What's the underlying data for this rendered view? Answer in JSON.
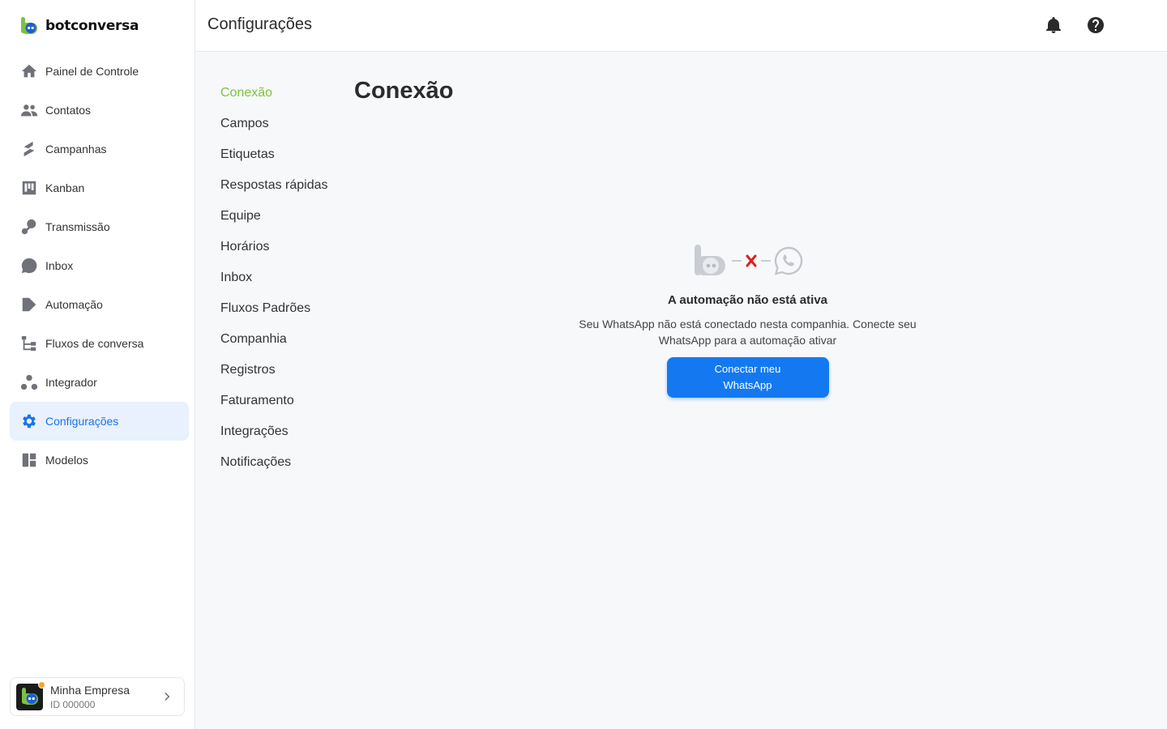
{
  "brand": {
    "name": "botconversa",
    "accent": "#7cc242",
    "primary": "#1479f0"
  },
  "sidebar": {
    "items": [
      {
        "label": "Painel de Controle",
        "icon": "home-icon"
      },
      {
        "label": "Contatos",
        "icon": "contacts-icon"
      },
      {
        "label": "Campanhas",
        "icon": "campaigns-icon"
      },
      {
        "label": "Kanban",
        "icon": "kanban-icon"
      },
      {
        "label": "Transmissão",
        "icon": "broadcast-icon"
      },
      {
        "label": "Inbox",
        "icon": "chat-bubble-icon"
      },
      {
        "label": "Automação",
        "icon": "automation-icon"
      },
      {
        "label": "Fluxos de conversa",
        "icon": "flow-icon"
      },
      {
        "label": "Integrador",
        "icon": "integrator-icon"
      },
      {
        "label": "Configurações",
        "icon": "gear-icon",
        "active": true
      },
      {
        "label": "Modelos",
        "icon": "templates-icon"
      }
    ]
  },
  "account": {
    "name": "Minha Empresa",
    "id": "ID 000000"
  },
  "header": {
    "title": "Configurações"
  },
  "settings_nav": {
    "items": [
      {
        "label": "Conexão",
        "active": true
      },
      {
        "label": "Campos"
      },
      {
        "label": "Etiquetas"
      },
      {
        "label": "Respostas rápidas"
      },
      {
        "label": "Equipe"
      },
      {
        "label": "Horários"
      },
      {
        "label": "Inbox"
      },
      {
        "label": "Fluxos Padrões"
      },
      {
        "label": "Companhia"
      },
      {
        "label": "Registros"
      },
      {
        "label": "Faturamento"
      },
      {
        "label": "Integrações"
      },
      {
        "label": "Notificações"
      }
    ]
  },
  "content": {
    "title": "Conexão",
    "empty_state": {
      "title": "A automação não está ativa",
      "description": "Seu WhatsApp não está conectado nesta companhia. Conecte seu WhatsApp para a automação ativar",
      "button_label": "Conectar meu WhatsApp"
    }
  }
}
